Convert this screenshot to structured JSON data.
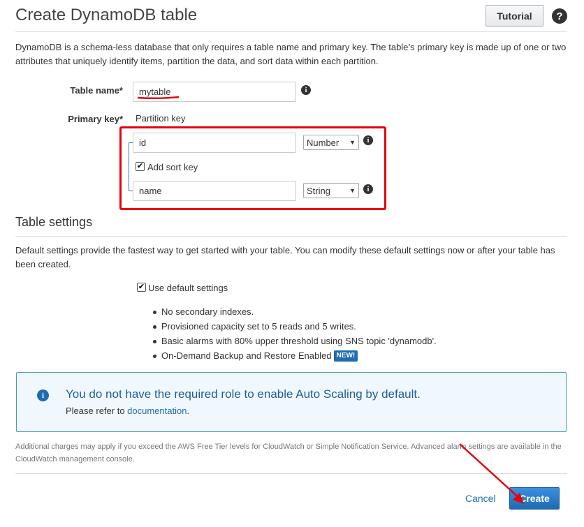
{
  "header": {
    "title": "Create DynamoDB table",
    "tutorial_label": "Tutorial",
    "help_glyph": "?"
  },
  "intro": "DynamoDB is a schema-less database that only requires a table name and primary key. The table’s primary key is made up of one or two attributes that uniquely identify items, partition the data, and sort data within each partition.",
  "table_name": {
    "label": "Table name*",
    "value": "mytable"
  },
  "primary_key": {
    "label": "Primary key*",
    "partition_label": "Partition key",
    "partition_value": "id",
    "partition_type": "Number",
    "add_sort_key_label": "Add sort key",
    "add_sort_key_checked": true,
    "sort_value": "name",
    "sort_type": "String"
  },
  "table_settings": {
    "heading": "Table settings",
    "description": "Default settings provide the fastest way to get started with your table. You can modify these default settings now or after your table has been created.",
    "use_default_label": "Use default settings",
    "use_default_checked": true,
    "bullets": [
      "No secondary indexes.",
      "Provisioned capacity set to 5 reads and 5 writes.",
      "Basic alarms with 80% upper threshold using SNS topic 'dynamodb'.",
      "On-Demand Backup and Restore Enabled"
    ],
    "new_badge": "NEW!"
  },
  "alert": {
    "title": "You do not have the required role to enable Auto Scaling by default.",
    "body_prefix": "Please refer to",
    "link": "documentation",
    "body_suffix": "."
  },
  "footer_note": "Additional charges may apply if you exceed the AWS Free Tier levels for CloudWatch or Simple Notification Service. Advanced alarm settings are available in the CloudWatch management console.",
  "actions": {
    "cancel": "Cancel",
    "create": "Create"
  },
  "colors": {
    "annotation_red": "#e8000b",
    "link_blue": "#1f6bb3",
    "primary_button": "#1f6bb3"
  },
  "icons": [
    "help-icon",
    "info-icon",
    "checkbox-checked",
    "chevron-down-icon"
  ]
}
